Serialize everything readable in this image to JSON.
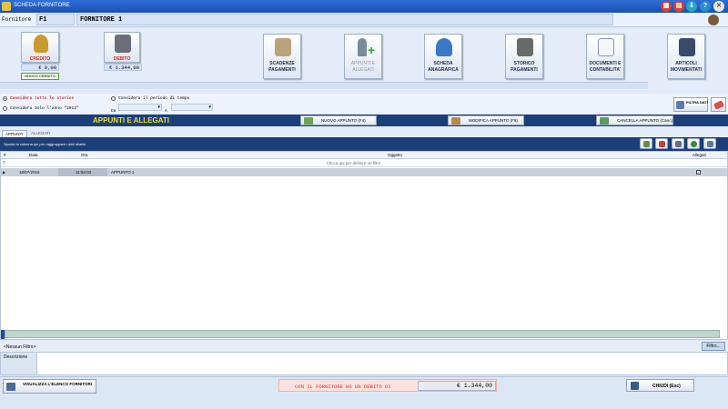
{
  "window": {
    "title": "SCHEDA FORNITORE"
  },
  "header": {
    "label": "Fornitore",
    "code": "F1",
    "name": "FORNITORE 1"
  },
  "credito": {
    "label": "CREDITO",
    "value": "€ 0,00",
    "new_button": "NUOVO CREDITO"
  },
  "debito": {
    "label": "DEBITO",
    "value": "€ 1.344,00"
  },
  "toolbar": [
    {
      "label": "SCADENZE PAGAMENTI",
      "color": "#b9a37a"
    },
    {
      "label": "APPUNTI E ALLEGATI",
      "color": "#7a8a9a"
    },
    {
      "label": "SCHEDA ANAGRAFICA",
      "color": "#3c78c8"
    },
    {
      "label": "STORICO PAGAMENTI",
      "color": "#6a6a6a"
    },
    {
      "label": "DOCUMENTI E CONTABILITA'",
      "color": "#d9dee8"
    },
    {
      "label": "ARTICOLI MOVIMENTATI",
      "color": "#3a4a6a"
    }
  ],
  "filters": {
    "all_history": "Considera tutto lo storico",
    "period": "Considera il periodo di tempo",
    "year_only": "Considera Solo l'anno \"2012\"",
    "from_label": "Da",
    "to_label": "A",
    "filter_button": "FILTRA DATI"
  },
  "section": {
    "title": "APPUNTI E ALLEGATI"
  },
  "actions": {
    "new": "NUOVO APPUNTO (F4)",
    "edit": "MODIFICA APPUNTO (F8)",
    "delete": "CANCELLA APPUNTO (Canc)"
  },
  "tabs": {
    "appunti": "APPUNTI",
    "allegati": "ALLEGATI"
  },
  "grid": {
    "group_hint": "Sposta la colonna qui per raggruppare i dati relativi",
    "columns": {
      "num": "#",
      "data": "Data",
      "ora": "Ora",
      "oggetto": "Oggetto",
      "allegati": "Allegati"
    },
    "filter_hint": "Clicca qui per definire un filtro",
    "rows": [
      {
        "data": "18/07/2016",
        "ora": "11:54:03",
        "oggetto": "APPUNTO 1"
      }
    ],
    "footer_filter": "<Nessun Filtro>",
    "filter_button": "Filtro..."
  },
  "description": {
    "label": "Descrizione"
  },
  "bottom": {
    "view_list": "VISUALIZZA L'ELENCO FORNITORI",
    "debt_message": "CON IL FORNITORE HO UN DEBITO DI",
    "debt_value": "€ 1.344,00",
    "close": "CHIUDI (Esc)"
  },
  "colors": {
    "accent": "#1c3f7a",
    "debt_text": "#e0301e",
    "highlight": "#f0e020"
  }
}
